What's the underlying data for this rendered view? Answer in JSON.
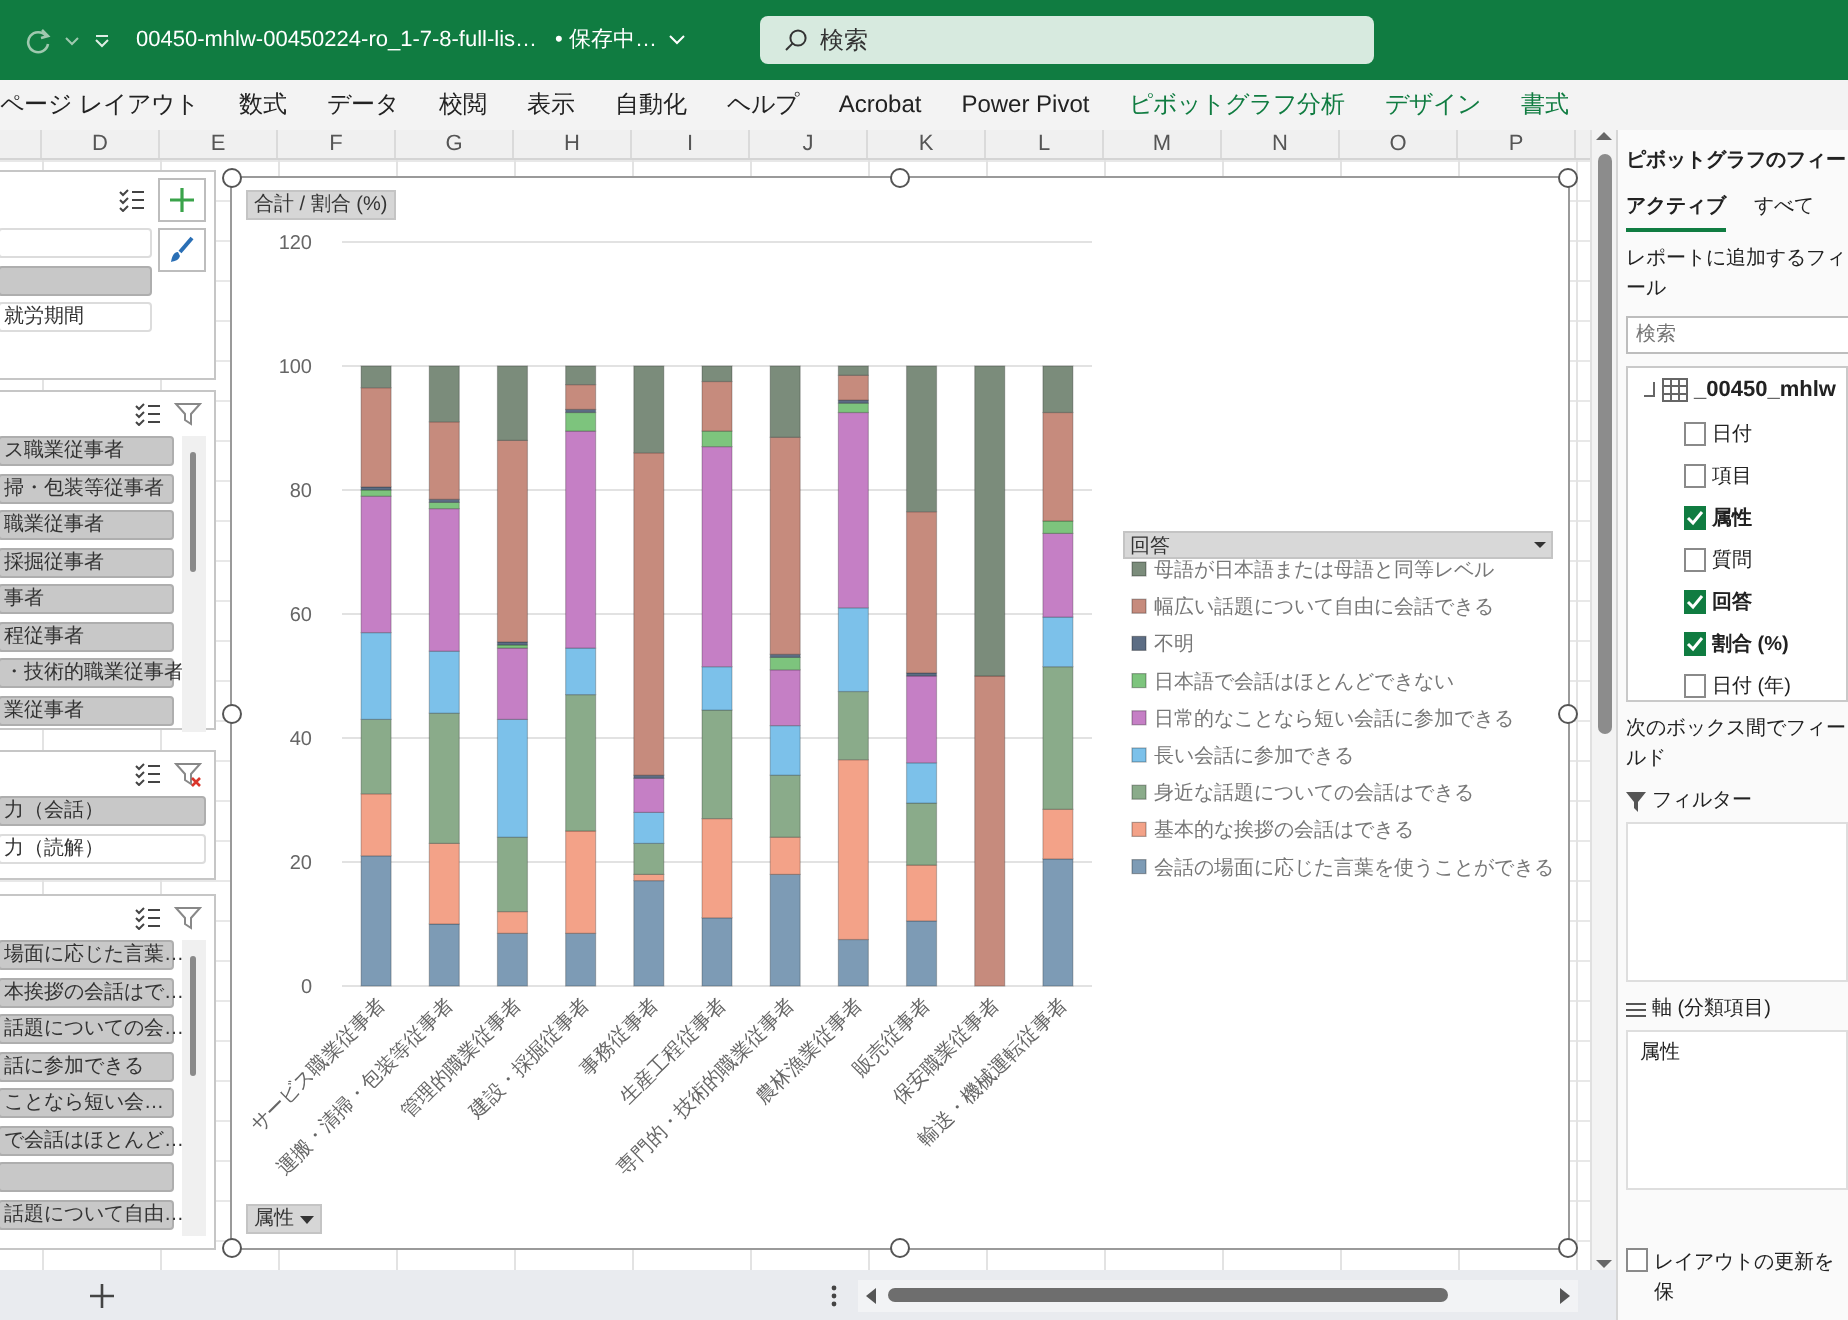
{
  "title_bar": {
    "file_name": "00450-mhlw-00450224-ro_1-7-8-full-lis…",
    "save_status": "• 保存中…",
    "search": {
      "placeholder": "検索"
    }
  },
  "ribbon_tabs": [
    {
      "label": "ページ レイアウト",
      "contextual": false
    },
    {
      "label": "数式",
      "contextual": false
    },
    {
      "label": "データ",
      "contextual": false
    },
    {
      "label": "校閲",
      "contextual": false
    },
    {
      "label": "表示",
      "contextual": false
    },
    {
      "label": "自動化",
      "contextual": false
    },
    {
      "label": "ヘルプ",
      "contextual": false
    },
    {
      "label": "Acrobat",
      "contextual": false
    },
    {
      "label": "Power Pivot",
      "contextual": false
    },
    {
      "label": "ピボットグラフ分析",
      "contextual": true
    },
    {
      "label": "デザイン",
      "contextual": true
    },
    {
      "label": "書式",
      "contextual": true
    }
  ],
  "columns": [
    "D",
    "E",
    "F",
    "G",
    "H",
    "I",
    "J",
    "K",
    "L",
    "M",
    "N",
    "O",
    "P"
  ],
  "slicers": [
    {
      "kind": "tools",
      "scrollable": false,
      "items": [
        {
          "selected": false
        },
        {
          "selected": true
        },
        {
          "label": "就労期間",
          "selected": false
        }
      ]
    },
    {
      "kind": "slicer",
      "filter_active": false,
      "scrollable": true,
      "items": [
        {
          "label": "ス職業従事者",
          "selected": true
        },
        {
          "label": "掃・包装等従事者",
          "selected": true
        },
        {
          "label": "職業従事者",
          "selected": true
        },
        {
          "label": "採掘従事者",
          "selected": true
        },
        {
          "label": "事者",
          "selected": true
        },
        {
          "label": "程従事者",
          "selected": true
        },
        {
          "label": "・技術的職業従事者",
          "selected": true
        },
        {
          "label": "業従事者",
          "selected": true
        }
      ]
    },
    {
      "kind": "slicer",
      "filter_active": true,
      "scrollable": false,
      "items": [
        {
          "label": "力（会話）",
          "selected": true
        },
        {
          "label": "力（読解）",
          "selected": false
        }
      ]
    },
    {
      "kind": "slicer",
      "filter_active": false,
      "scrollable": true,
      "items": [
        {
          "label": "場面に応じた言葉…",
          "selected": true
        },
        {
          "label": "本挨拶の会話はで…",
          "selected": true
        },
        {
          "label": "話題についての会…",
          "selected": true
        },
        {
          "label": "話に参加できる",
          "selected": true
        },
        {
          "label": "ことなら短い会…",
          "selected": true
        },
        {
          "label": "で会話はほとんど…",
          "selected": true
        },
        {
          "selected": true
        },
        {
          "label": "話題について自由…",
          "selected": true
        }
      ]
    }
  ],
  "chart": {
    "selected": true,
    "value_field_button": "合計 / 割合 (%)",
    "axis_field_button": "属性",
    "legend_field_button": "回答",
    "chart_data": {
      "type": "bar",
      "stacked": true,
      "grid": true,
      "legend": true,
      "orientation": "vertical",
      "ylim": [
        0,
        120
      ],
      "yticks": [
        0,
        20,
        40,
        60,
        80,
        100,
        120
      ],
      "categories": [
        "サービス職業従事者",
        "運搬・清掃・包装等従事者",
        "管理的職業従事者",
        "建設・採掘従事者",
        "事務従事者",
        "生産工程従事者",
        "専門的・技術的職業従事者",
        "農林漁業従事者",
        "販売従事者",
        "保安職業従事者",
        "輸送・機械運転従事者"
      ],
      "series": [
        {
          "name": "母語が日本語または母語と同等レベル",
          "color": "#7b8c7b",
          "values": [
            3.5,
            9,
            12,
            3,
            14,
            2.5,
            11.5,
            1.5,
            23.5,
            50,
            7.5
          ]
        },
        {
          "name": "幅広い話題について自由に会話できる",
          "color": "#c68b7d",
          "values": [
            16,
            12.5,
            32.5,
            4,
            52,
            8,
            35,
            4,
            26,
            50,
            17.5
          ]
        },
        {
          "name": "不明",
          "color": "#5c6d84",
          "values": [
            0.5,
            0.5,
            0.5,
            0.5,
            0.5,
            0,
            0.5,
            0.5,
            0.5,
            0,
            0
          ]
        },
        {
          "name": "日本語で会話はほとんどできない",
          "color": "#7dc47d",
          "values": [
            1,
            1,
            0.5,
            3,
            0,
            2.5,
            2,
            1.5,
            0,
            0,
            2
          ]
        },
        {
          "name": "日常的なことなら短い会話に参加できる",
          "color": "#c57fc5",
          "values": [
            22,
            23,
            11.5,
            35,
            5.5,
            35.5,
            9,
            31.5,
            14,
            0,
            13.5
          ]
        },
        {
          "name": "長い会話に参加できる",
          "color": "#7cc1ea",
          "values": [
            14,
            10,
            19,
            7.5,
            5,
            7,
            8,
            13.5,
            6.5,
            0,
            8
          ]
        },
        {
          "name": "身近な話題についての会話はできる",
          "color": "#8aab8a",
          "values": [
            12,
            21,
            12,
            22,
            5,
            17.5,
            10,
            11,
            10,
            0,
            23
          ]
        },
        {
          "name": "基本的な挨拶の会話はできる",
          "color": "#f3a288",
          "values": [
            10,
            13,
            3.5,
            16.5,
            1,
            16,
            6,
            29,
            9,
            0,
            8
          ]
        },
        {
          "name": "会話の場面に応じた言葉を使うことができる",
          "color": "#7d9bb5",
          "values": [
            21,
            10,
            8.5,
            8.5,
            17,
            11,
            18,
            7.5,
            10.5,
            0,
            20.5
          ]
        }
      ]
    }
  },
  "field_pane": {
    "title": "ピボットグラフのフィー",
    "tabs": [
      {
        "label": "アクティブ",
        "selected": true
      },
      {
        "label": "すべて",
        "selected": false
      }
    ],
    "add_fields_label": "レポートに追加するフィール",
    "search": {
      "placeholder": "検索"
    },
    "table": {
      "name": "_00450_mhlw",
      "expanded": true,
      "children": [
        {
          "label": "日付",
          "checked": false
        },
        {
          "label": "項目",
          "checked": false
        },
        {
          "label": "属性",
          "checked": true
        },
        {
          "label": "質問",
          "checked": false
        },
        {
          "label": "回答",
          "checked": true
        },
        {
          "label": "割合 (%)",
          "checked": true
        },
        {
          "label": "日付 (年)",
          "checked": false
        }
      ]
    },
    "drag_label": "次のボックス間でフィールド",
    "areas": [
      {
        "kind": "filter",
        "label": "フィルター"
      },
      {
        "kind": "axis",
        "label": "軸 (分類項目)",
        "items": [
          "属性"
        ]
      }
    ],
    "defer_update": {
      "label": "レイアウトの更新を保",
      "checked": false
    }
  }
}
